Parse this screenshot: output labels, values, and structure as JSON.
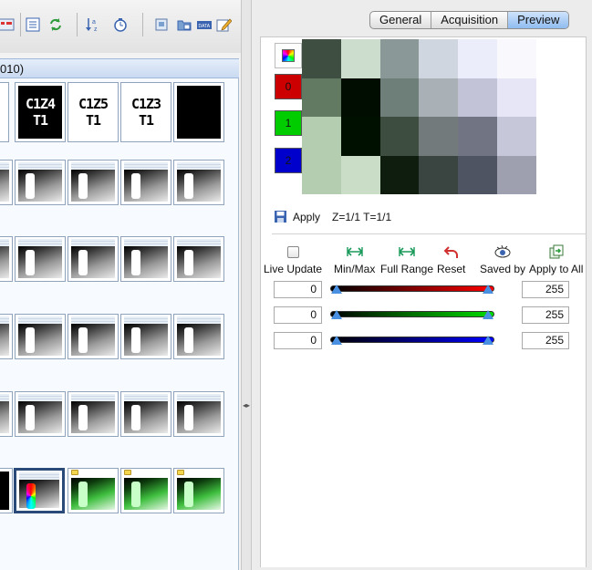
{
  "left": {
    "tree_header": "010)",
    "label_thumbs": [
      {
        "line1": "C1Z4",
        "line2": "T1",
        "dark": true
      },
      {
        "line1": "C1Z5",
        "line2": "T1",
        "dark": false
      },
      {
        "line1": "C1Z3",
        "line2": "T1",
        "dark": false
      }
    ]
  },
  "tabs": [
    {
      "label": "General",
      "active": false
    },
    {
      "label": "Acquisition",
      "active": false
    },
    {
      "label": "Preview",
      "active": true
    }
  ],
  "channels": [
    {
      "label": "0",
      "color": "#cc0000"
    },
    {
      "label": "1",
      "color": "#00cc00"
    },
    {
      "label": "2",
      "color": "#0000cc"
    }
  ],
  "pixel_grid": [
    [
      "#3e4e40",
      "#ccdccd",
      "#8a9898",
      "#d0d6e0",
      "#ecedfa",
      "#f8f8fd"
    ],
    [
      "#627a62",
      "#000d00",
      "#6e7e78",
      "#a9b0b6",
      "#c2c3d6",
      "#e6e6f6"
    ],
    [
      "#b4cdb0",
      "#001000",
      "#3d4e41",
      "#737a7b",
      "#707483",
      "#c6c7d8"
    ],
    [
      "#b4cdb0",
      "#c9ddc7",
      "#0e1d0e",
      "#3a4542",
      "#4f5463",
      "#9ea0b0"
    ]
  ],
  "apply": {
    "label": "Apply",
    "zt_text": "Z=1/1 T=1/1"
  },
  "controls": [
    {
      "label": "Live Update",
      "icon": "checkbox-icon"
    },
    {
      "label": "Min/Max",
      "icon": "arrows-horizontal-icon"
    },
    {
      "label": "Full Range",
      "icon": "arrows-horizontal-icon"
    },
    {
      "label": "Reset",
      "icon": "undo-arrow-icon"
    },
    {
      "label": "Saved by",
      "icon": "eye-icon"
    },
    {
      "label": "Apply to All",
      "icon": "copy-apply-icon"
    }
  ],
  "sliders": [
    {
      "min": "0",
      "max": "255",
      "color": "#ff0000"
    },
    {
      "min": "0",
      "max": "255",
      "color": "#00dd00"
    },
    {
      "min": "0",
      "max": "255",
      "color": "#0000ff"
    }
  ]
}
